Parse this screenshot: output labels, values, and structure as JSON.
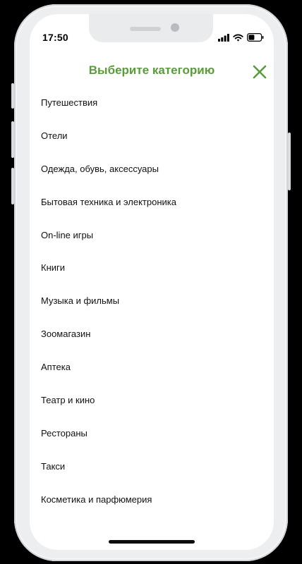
{
  "status_bar": {
    "time": "17:50",
    "icons": [
      "signal-icon",
      "wifi-icon",
      "battery-icon"
    ]
  },
  "header": {
    "title": "Выберите категорию",
    "close_icon": "close-icon"
  },
  "colors": {
    "accent": "#5a9b3a",
    "text": "#111111",
    "frame": "#eceeef",
    "background": "#000000"
  },
  "categories": [
    {
      "label": "Путешествия"
    },
    {
      "label": "Отели"
    },
    {
      "label": "Одежда, обувь, аксессуары"
    },
    {
      "label": "Бытовая техника и электроника"
    },
    {
      "label": "On-line игры"
    },
    {
      "label": "Книги"
    },
    {
      "label": "Музыка и фильмы"
    },
    {
      "label": "Зоомагазин"
    },
    {
      "label": "Аптека"
    },
    {
      "label": "Театр и кино"
    },
    {
      "label": "Рестораны"
    },
    {
      "label": "Такси"
    },
    {
      "label": "Косметика и парфюмерия"
    }
  ]
}
